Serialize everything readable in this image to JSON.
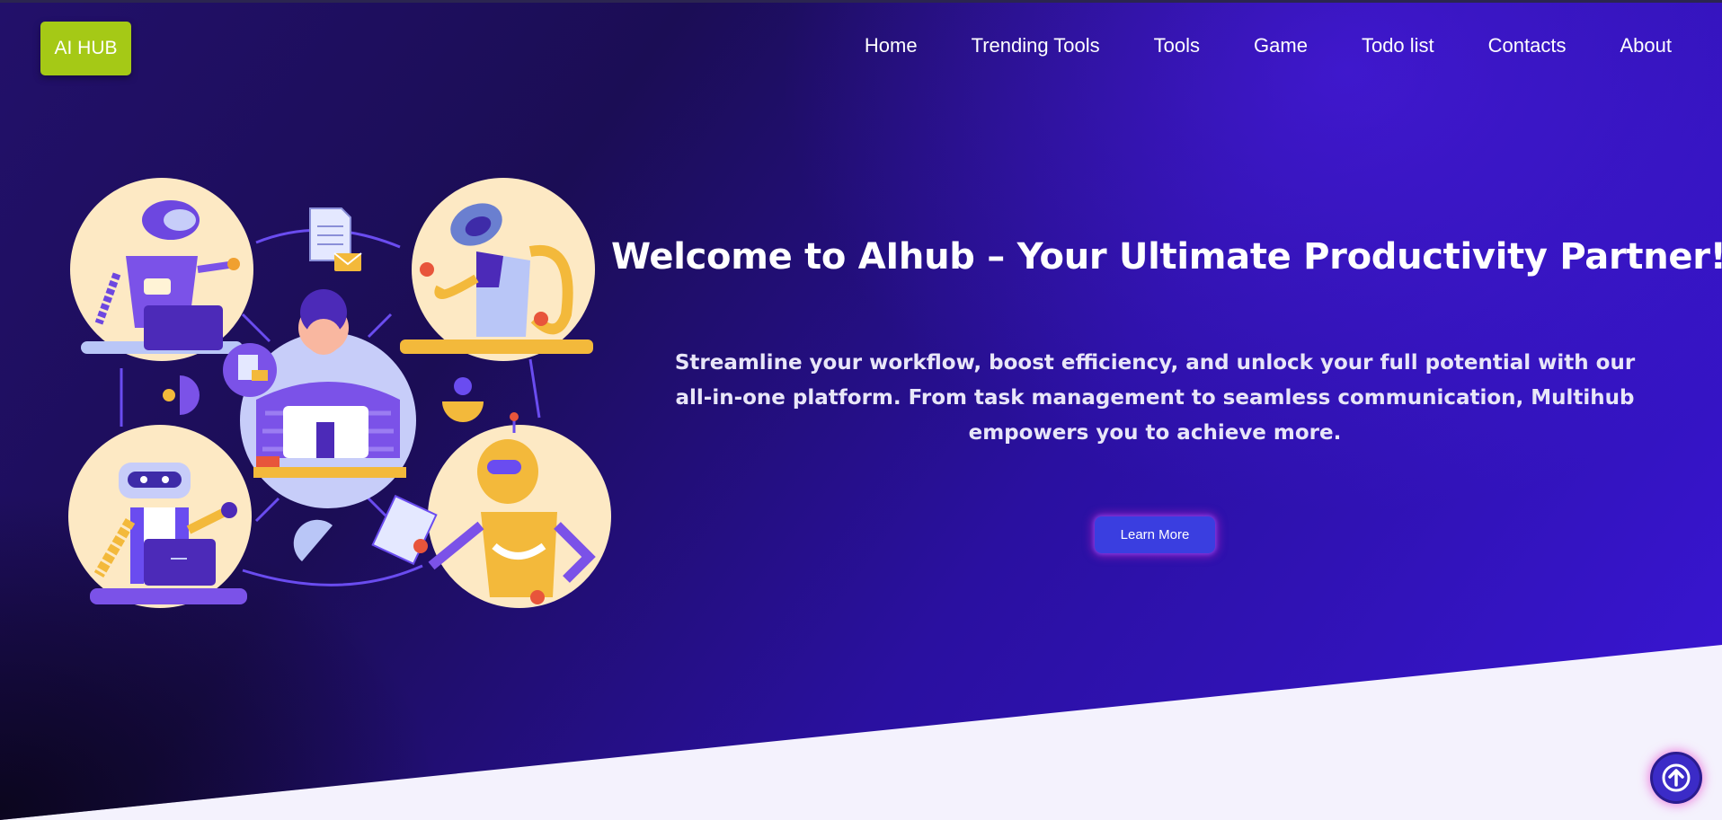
{
  "header": {
    "logo_text": "AI HUB",
    "nav": [
      "Home",
      "Trending Tools",
      "Tools",
      "Game",
      "Todo list",
      "Contacts",
      "About"
    ]
  },
  "hero": {
    "title": "Welcome to AIhub – Your Ultimate Productivity Partner!!",
    "subtitle_lines": [
      "Streamline your workflow, boost efficiency, and unlock your full potential with our",
      "all-in-one platform. From task management to seamless communication, Multihub",
      "empowers you to achieve more."
    ],
    "cta_label": "Learn More"
  },
  "icons": {
    "scroll_top": "arrow-up-circle-icon",
    "illustration": "robots-collaboration-illustration"
  },
  "colors": {
    "logo_bg": "#a5c916",
    "hero_dark": "#1b0d55",
    "hero_accent": "#3a16d6",
    "button": "#3a3ee0",
    "page_bg": "#f4f2fd"
  }
}
